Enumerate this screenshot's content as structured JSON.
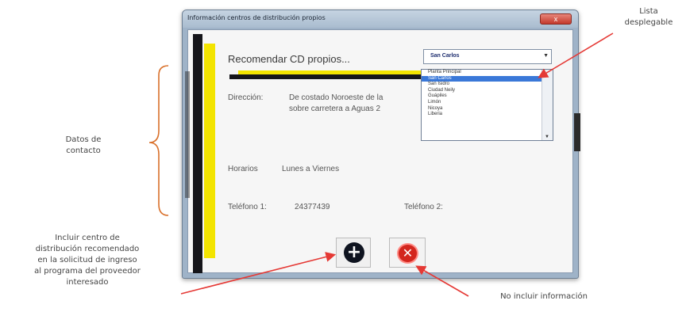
{
  "window": {
    "title": "Información centros de distribución propios",
    "close_label": "x"
  },
  "form": {
    "heading": "Recomendar CD propios...",
    "address_label": "Dirección:",
    "address_line1": "De costado Noroeste de la",
    "address_line2": "sobre carretera a Aguas 2",
    "hours_label": "Horarios",
    "hours_value": "Lunes a Viernes",
    "phone1_label": "Teléfono 1:",
    "phone1_value": "24377439",
    "phone2_label": "Teléfono 2:"
  },
  "dropdown": {
    "selected": "San Carlos",
    "options": [
      "Planta Principal",
      "San Carlos",
      "San Isidro",
      "Ciudad Neily",
      "Guápiles",
      "Limón",
      "Nicoya",
      "Liberia"
    ],
    "highlighted_index": 1,
    "highlight_color": "#3a78d8"
  },
  "buttons": {
    "add_symbol": "+",
    "no_symbol": "✕"
  },
  "annotations": {
    "lista": [
      "Lista",
      "desplegable"
    ],
    "datos": [
      "Datos de",
      "contacto"
    ],
    "incluir": [
      "Incluir centro de",
      "distribución recomendado",
      "en la solicitud de ingreso",
      "al programa del proveedor",
      "interesado"
    ],
    "no_incluir": "No incluir información"
  },
  "colors": {
    "accent_yellow": "#f3e400",
    "bar_black": "#15151a",
    "arrow_red": "#e53935",
    "bracket_orange": "#d9702a"
  }
}
